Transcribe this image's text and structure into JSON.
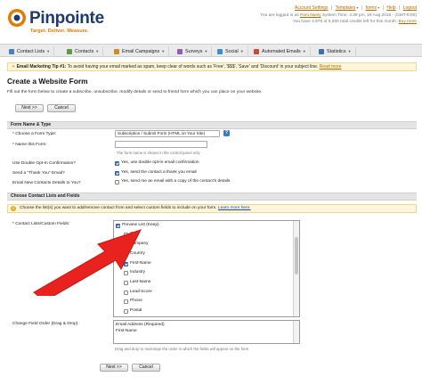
{
  "brand": {
    "name": "Pinpointe",
    "tagline": "Target. Deliver. Measure.",
    "accent": "#e07b00",
    "navy": "#1f3a6b"
  },
  "toplinks": {
    "items": [
      "Account Settings",
      "Templates",
      "forms",
      "Help",
      "Logout"
    ]
  },
  "account": {
    "line1_prefix": "You are logged in as ",
    "user": "Pam Neely",
    "line1_suffix": " System Time: 4:39 pm, 18 Aug 2015 - (GMT-8:00)",
    "line2_prefix": "You have 4,975 of 5,000 total credits left for this month.",
    "line2_link": "Buy more"
  },
  "nav": {
    "items": [
      {
        "label": "Contact Lists",
        "icon": "contact-lists-icon",
        "color": "#4a7fc1"
      },
      {
        "label": "Contacts",
        "icon": "contacts-icon",
        "color": "#5b9a3e"
      },
      {
        "label": "Email Campaigns",
        "icon": "email-campaigns-icon",
        "color": "#d08a2a"
      },
      {
        "label": "Surveys",
        "icon": "surveys-icon",
        "color": "#8e5fb5"
      },
      {
        "label": "Social",
        "icon": "social-icon",
        "color": "#3b8fc8"
      },
      {
        "label": "Automated Emails",
        "icon": "automated-emails-icon",
        "color": "#c94a3a"
      },
      {
        "label": "Statistics",
        "icon": "statistics-icon",
        "color": "#3c6fb0"
      }
    ]
  },
  "tip": {
    "prefix": "Email Marketing Tip #1:",
    "text": " To avoid having your email marked as spam, keep clear of words such as 'Free', '$$$', 'Save' and 'Discount' in your subject line.",
    "link": "Read more"
  },
  "page": {
    "title": "Create a Website Form",
    "intro": "Fill out the form below to create a subscribe, unsubscribe, modify details or send to friend form which you can place on your website."
  },
  "buttons": {
    "next": "Next >>",
    "cancel": "Cancel"
  },
  "section1": {
    "title": "Form Name & Type",
    "form_type_label": "* Choose a Form Type:",
    "form_type_value": "Subscription / Submit Form (HTML on Your Site)",
    "form_name_label": "* Name this Form:",
    "form_name_value": "",
    "form_name_note": "The form name is shown in the control panel only",
    "double_optin_label": "Use Double Opt-In Confirmation?",
    "double_optin_option": "Yes, use double opt-in email confirmation",
    "thankyou_label": "Send a \"Thank You\" Email?",
    "thankyou_option": "Yes, send the contact a thank you email",
    "new_details_label": "Email New Contacts Details to You?",
    "new_details_option": "Yes, send me an email with a copy of the contact's details"
  },
  "section2": {
    "title": "Choose Contact Lists and Fields",
    "info": "Choose the list(s) you want to add/remove contact from and select custom fields to include on your form.",
    "info_link": "Learn more here.",
    "lists_label": "* Contact Lists/Custom Fields:",
    "list_items": [
      {
        "label": "Preview List (Keep)",
        "checked": true,
        "indent": false
      },
      {
        "label": "City",
        "checked": false,
        "indent": true
      },
      {
        "label": "Company",
        "checked": false,
        "indent": true
      },
      {
        "label": "Country",
        "checked": false,
        "indent": true
      },
      {
        "label": "First-Name",
        "checked": true,
        "indent": true
      },
      {
        "label": "Industry",
        "checked": false,
        "indent": true
      },
      {
        "label": "Last-Name",
        "checked": false,
        "indent": true
      },
      {
        "label": "Lead-Score",
        "checked": false,
        "indent": true
      },
      {
        "label": "Phone",
        "checked": false,
        "indent": true
      },
      {
        "label": "Postal",
        "checked": false,
        "indent": true
      }
    ],
    "order_label": "Change Field Order (Drag & Drop):",
    "order_items": [
      "Email Address (Required)",
      "First-Name"
    ],
    "order_note": "Drag and drop to rearrange the order in which the fields will appear on the form"
  }
}
